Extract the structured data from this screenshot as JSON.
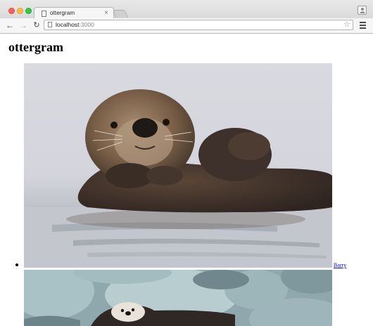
{
  "browser": {
    "tab": {
      "title": "ottergram",
      "close_glyph": "×",
      "favicon": "page-icon"
    },
    "address": {
      "host": "localhost",
      "port": ":3000"
    },
    "icons": {
      "back": "arrow-left-icon",
      "forward": "arrow-right-icon",
      "reload": "reload-icon",
      "bookmark": "star-icon",
      "menu": "hamburger-menu-icon",
      "profile": "user-icon"
    },
    "colors": {
      "close": "#fc605b",
      "minimize": "#fdbc40",
      "zoom": "#34c84a"
    }
  },
  "page": {
    "heading": "ottergram",
    "thumbnails": [
      {
        "title": "Barry",
        "image": "sea otter floating on back in water"
      },
      {
        "title": "",
        "image": "sea otter resting among rocks"
      }
    ],
    "link_color": "#0000ee"
  }
}
